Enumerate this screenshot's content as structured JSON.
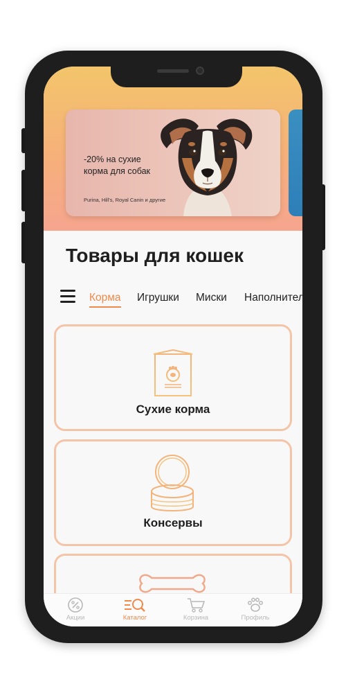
{
  "promo": {
    "title": "-20% на сухие корма для собак",
    "subtitle": "Purina, Hill's, Royal Canin и другие"
  },
  "page": {
    "title": "Товары для кошек"
  },
  "tabs": [
    {
      "label": "Корма",
      "active": true
    },
    {
      "label": "Игрушки",
      "active": false
    },
    {
      "label": "Миски",
      "active": false
    },
    {
      "label": "Наполнители",
      "active": false
    }
  ],
  "categories": [
    {
      "label": "Сухие корма",
      "icon": "dry-food-bag-icon"
    },
    {
      "label": "Консервы",
      "icon": "canned-food-icon"
    },
    {
      "label": "",
      "icon": "bone-icon"
    }
  ],
  "bottom_nav": [
    {
      "label": "Акции",
      "icon": "percent-icon",
      "active": false
    },
    {
      "label": "Каталог",
      "icon": "catalog-search-icon",
      "active": true
    },
    {
      "label": "Корзина",
      "icon": "cart-icon",
      "active": false
    },
    {
      "label": "Профиль",
      "icon": "paw-icon",
      "active": false
    }
  ],
  "colors": {
    "accent": "#f08a4b",
    "card_border": "#f4c4a9",
    "hero_top": "#f3c56b",
    "hero_bottom": "#f6a58e"
  }
}
